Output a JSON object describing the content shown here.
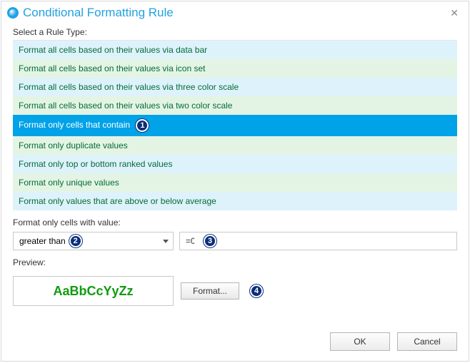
{
  "window": {
    "title": "Conditional Formatting Rule"
  },
  "labels": {
    "select_rule_type": "Select a Rule Type:",
    "format_only_cells": "Format only cells with value:",
    "preview": "Preview:"
  },
  "rule_types": [
    {
      "label": "Format all cells based on their values via data bar",
      "selected": false
    },
    {
      "label": "Format all cells based on their values via icon set",
      "selected": false
    },
    {
      "label": "Format all cells based on their values via three color scale",
      "selected": false
    },
    {
      "label": "Format all cells based on their values via two color scale",
      "selected": false
    },
    {
      "label": "Format only cells that contain",
      "selected": true
    },
    {
      "label": "Format only duplicate values",
      "selected": false
    },
    {
      "label": "Format only top or bottom ranked values",
      "selected": false
    },
    {
      "label": "Format only unique values",
      "selected": false
    },
    {
      "label": "Format only values that are above or below average",
      "selected": false
    }
  ],
  "condition": {
    "operator": "greater than",
    "value": "=0"
  },
  "preview": {
    "sample_text": "AaBbCcYyZz",
    "color": "#109b10"
  },
  "buttons": {
    "format": "Format...",
    "ok": "OK",
    "cancel": "Cancel"
  },
  "callouts": {
    "selected_rule": "1",
    "operator": "2",
    "value": "3",
    "format": "4"
  }
}
